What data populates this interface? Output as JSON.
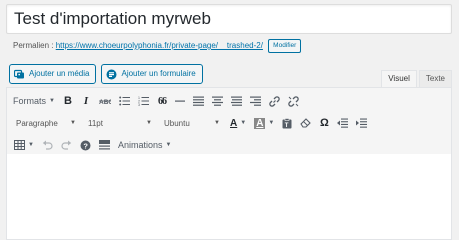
{
  "post": {
    "title": "Test d'importation myrweb"
  },
  "permalink": {
    "label": "Permalien :",
    "url": "https://www.choeurpolyphonia.fr/private-page/__trashed-2/",
    "edit_button": "Modifier"
  },
  "media_buttons": {
    "add_media": "Ajouter un média",
    "add_form": "Ajouter un formulaire"
  },
  "editor_tabs": {
    "visual": "Visuel",
    "text": "Texte",
    "active": "visual"
  },
  "toolbar": {
    "formats_label": "Formats",
    "paragraph_select": "Paragraphe",
    "font_size_select": "11pt",
    "font_family_select": "Ubuntu",
    "animations_label": "Animations",
    "bold_label": "B",
    "italic_label": "I",
    "quote_label": "66",
    "font_color_label": "A",
    "bg_color_label": "A",
    "omega_label": "Ω"
  },
  "colors": {
    "accent": "#0071a1",
    "link": "#0073aa",
    "font_color_bar": "#e14d43",
    "bg_color_bar": "#1e73be"
  }
}
